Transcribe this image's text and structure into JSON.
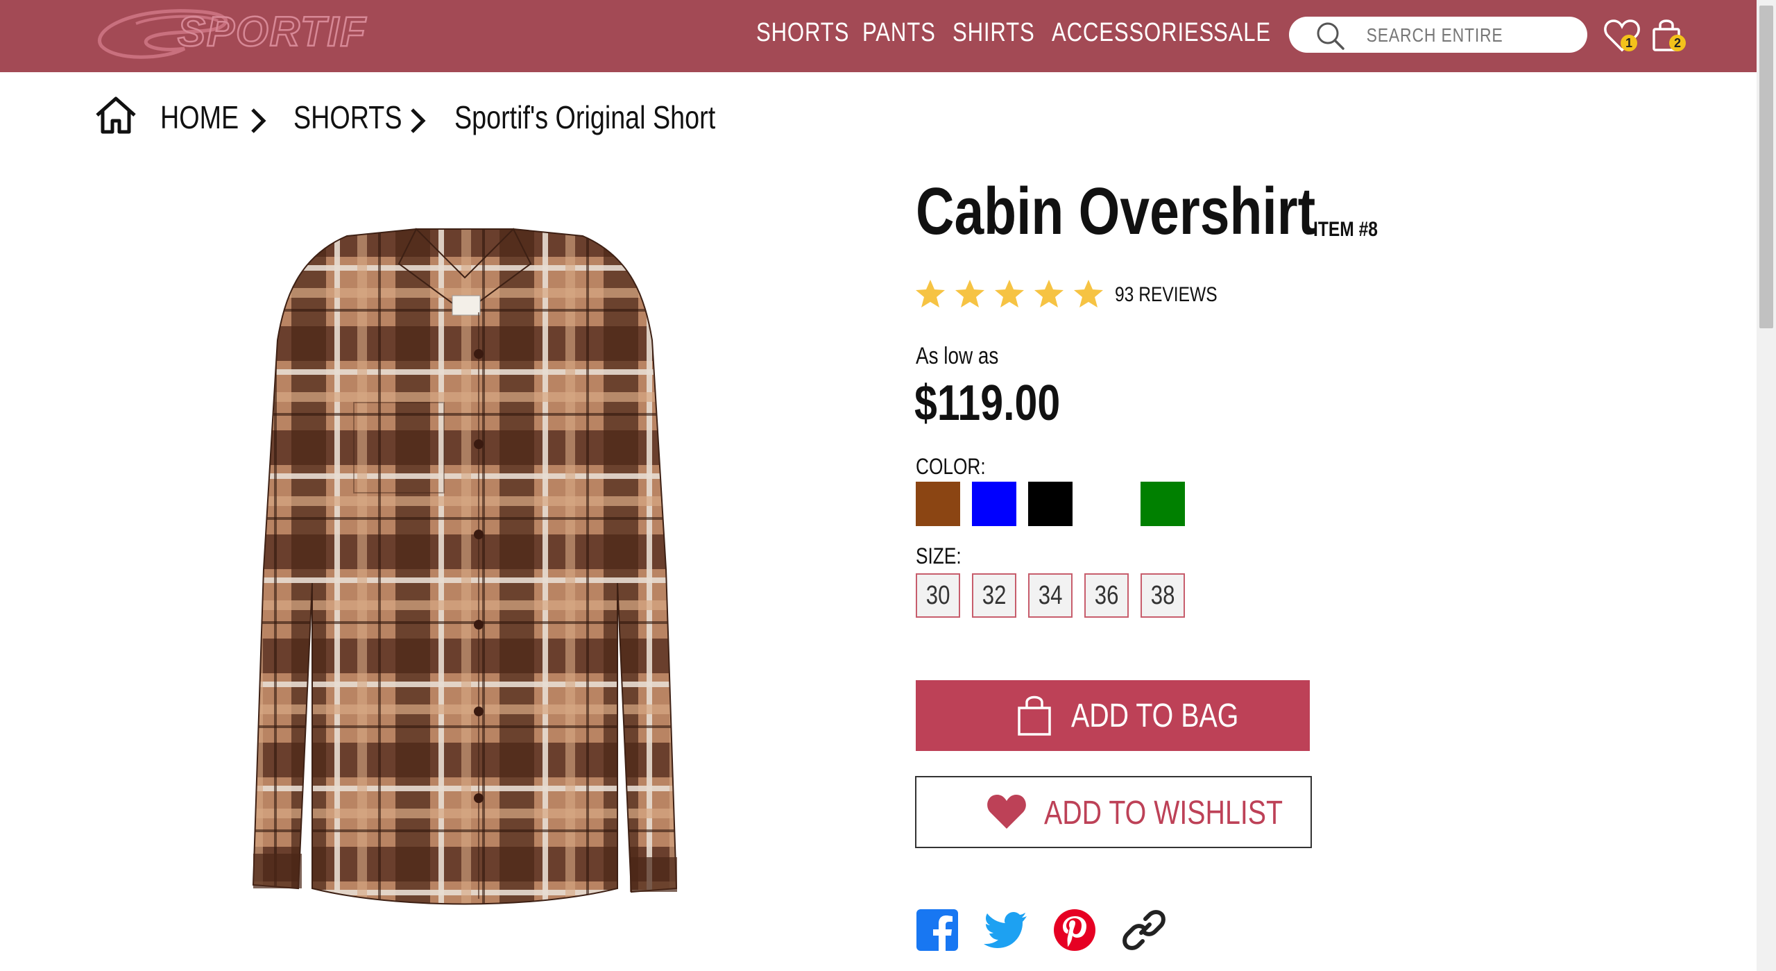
{
  "brand": {
    "name": "SPORTIF"
  },
  "nav": {
    "items": [
      "SHORTS",
      "PANTS",
      "SHIRTS",
      "ACCESSORIES",
      "SALE"
    ]
  },
  "search": {
    "placeholder": "SEARCH ENTIRE"
  },
  "header_icons": {
    "wishlist_count": "1",
    "cart_count": "2"
  },
  "breadcrumb": {
    "home": "HOME",
    "category": "SHORTS",
    "current": "Sportif's Original Short"
  },
  "product": {
    "title": "Cabin Overshirt",
    "item_no": "ITEM #8",
    "rating": 5,
    "reviews": "93 REVIEWS",
    "price_prefix": "As low as",
    "price": "$119.00",
    "color_label": "COLOR:",
    "colors": [
      "#8b4513",
      "#0000ff",
      "#000000",
      "#ffffff",
      "#008000"
    ],
    "size_label": "SIZE:",
    "sizes": [
      "30",
      "32",
      "34",
      "36",
      "38"
    ],
    "add_to_bag": "ADD TO BAG",
    "add_to_wishlist": "ADD TO WISHLIST"
  },
  "social": [
    "facebook-icon",
    "twitter-icon",
    "pinterest-icon",
    "link-icon"
  ],
  "colors": {
    "header": "#a34a55",
    "accent": "#bd4157",
    "star": "#f6c343",
    "badge": "#f3c21b"
  }
}
